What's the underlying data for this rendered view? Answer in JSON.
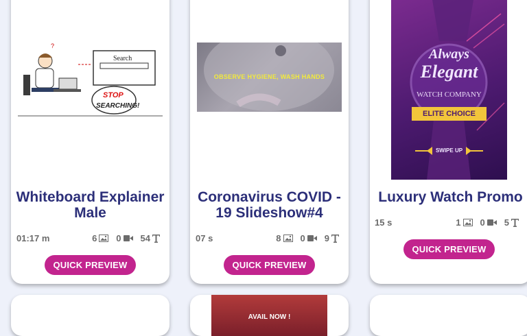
{
  "cards": [
    {
      "title_line1": "Whiteboard Explainer",
      "title_line2": "Male",
      "duration": "01:17 m",
      "images": "6",
      "videos": "0",
      "texts": "54",
      "thumb_text_1": "Search",
      "thumb_text_2": "STOP",
      "thumb_text_3": "SEARCHING!",
      "button": "QUICK PREVIEW"
    },
    {
      "title_line1": "Coronavirus COVID -",
      "title_line2": "19 Slideshow#4",
      "duration": "07 s",
      "images": "8",
      "videos": "0",
      "texts": "9",
      "thumb_text": "OBSERVE HYGIENE, WASH HANDS",
      "button": "QUICK PREVIEW"
    },
    {
      "title_line1": "Luxury Watch Promo",
      "duration": "15 s",
      "images": "1",
      "videos": "0",
      "texts": "5",
      "thumb_text_1": "Always",
      "thumb_text_2": "Elegant",
      "thumb_text_3": "WATCH COMPANY",
      "thumb_text_4": "ELITE CHOICE",
      "thumb_text_5": "SWIPE UP",
      "button": "QUICK PREVIEW"
    }
  ],
  "bottom_cards": [
    {
      "thumb_text": "AVAIL NOW !"
    }
  ],
  "icons": {
    "image": "image-icon",
    "video": "video-camera-icon",
    "text": "text-t-icon"
  },
  "colors": {
    "title": "#2c2f79",
    "button": "#c2248e",
    "background": "#eef1fa"
  }
}
